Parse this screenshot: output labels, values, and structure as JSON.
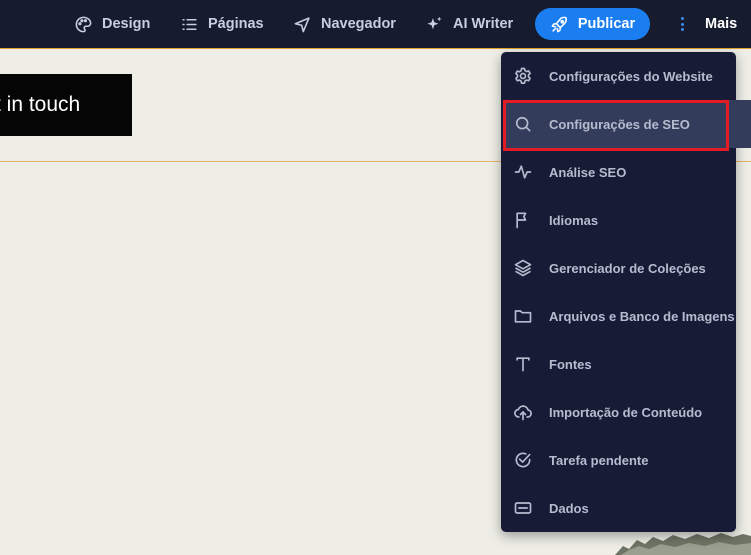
{
  "topbar": {
    "design_label": "Design",
    "pages_label": "Páginas",
    "navigator_label": "Navegador",
    "ai_writer_label": "AI Writer",
    "publish_label": "Publicar",
    "more_label": "Mais"
  },
  "page": {
    "hero_button_text": "t in touch"
  },
  "menu": {
    "items": [
      {
        "label": "Configurações do Website",
        "icon": "gear-icon"
      },
      {
        "label": "Configurações de SEO",
        "icon": "search-icon"
      },
      {
        "label": "Análise SEO",
        "icon": "activity-icon"
      },
      {
        "label": "Idiomas",
        "icon": "flag-icon"
      },
      {
        "label": "Gerenciador de Coleções",
        "icon": "layers-icon"
      },
      {
        "label": "Arquivos e Banco de Imagens",
        "icon": "folder-icon"
      },
      {
        "label": "Fontes",
        "icon": "type-icon"
      },
      {
        "label": "Importação de Conteúdo",
        "icon": "upload-cloud-icon"
      },
      {
        "label": "Tarefa pendente",
        "icon": "check-circle-icon"
      },
      {
        "label": "Dados",
        "icon": "card-icon"
      }
    ],
    "active_item": "Configurações de SEO"
  },
  "colors": {
    "topbar_bg": "#171b2e",
    "menu_bg": "#171b35",
    "publish_blue": "#1a7ef0",
    "highlight_red": "#e41a24"
  }
}
